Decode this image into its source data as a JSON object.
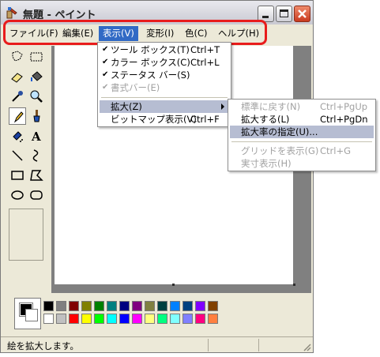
{
  "window": {
    "title": "無題 - ペイント"
  },
  "menubar": {
    "items": [
      "ファイル(F)",
      "編集(E)",
      "表示(V)",
      "変形(I)",
      "色(C)",
      "ヘルプ(H)"
    ]
  },
  "view_menu": {
    "items": [
      {
        "label": "ツール ボックス(T)",
        "shortcut": "Ctrl+T",
        "checked": "✔"
      },
      {
        "label": "カラー ボックス(C)",
        "shortcut": "Ctrl+L",
        "checked": "✔"
      },
      {
        "label": "ステータス バー(S)",
        "shortcut": "",
        "checked": "✔"
      },
      {
        "label": "書式バー(E)",
        "shortcut": "",
        "checked": "✔"
      },
      {
        "label": "拡大(Z)",
        "shortcut": ""
      },
      {
        "label": "ビットマップ表示(V)",
        "shortcut": "Ctrl+F"
      }
    ]
  },
  "zoom_menu": {
    "items": [
      {
        "label": "標準に戻す(N)",
        "shortcut": "Ctrl+PgUp"
      },
      {
        "label": "拡大する(L)",
        "shortcut": "Ctrl+PgDn"
      },
      {
        "label": "拡大率の指定(U)...",
        "shortcut": ""
      },
      {
        "label": "グリッドを表示(G)",
        "shortcut": "Ctrl+G"
      },
      {
        "label": "実寸表示(H)",
        "shortcut": ""
      }
    ]
  },
  "toolbox": {
    "tools": [
      "free-select",
      "rect-select",
      "eraser",
      "fill",
      "eyedropper",
      "magnifier",
      "pencil",
      "brush",
      "airbrush",
      "text",
      "line",
      "curve",
      "rectangle",
      "polygon",
      "ellipse",
      "rounded-rectangle"
    ],
    "selected": "pencil"
  },
  "palette": {
    "top_row": [
      "#000000",
      "#808080",
      "#800000",
      "#808000",
      "#008000",
      "#008080",
      "#000080",
      "#800080",
      "#808040",
      "#004040",
      "#0080ff",
      "#004080",
      "#8000ff",
      "#804000"
    ],
    "bottom_row": [
      "#ffffff",
      "#c0c0c0",
      "#ff0000",
      "#ffff00",
      "#00ff00",
      "#00ffff",
      "#0000ff",
      "#ff00ff",
      "#ffff80",
      "#00ff80",
      "#80ffff",
      "#8080ff",
      "#ff0080",
      "#ff8040"
    ]
  },
  "statusbar": {
    "text": "絵を拡大します。"
  }
}
